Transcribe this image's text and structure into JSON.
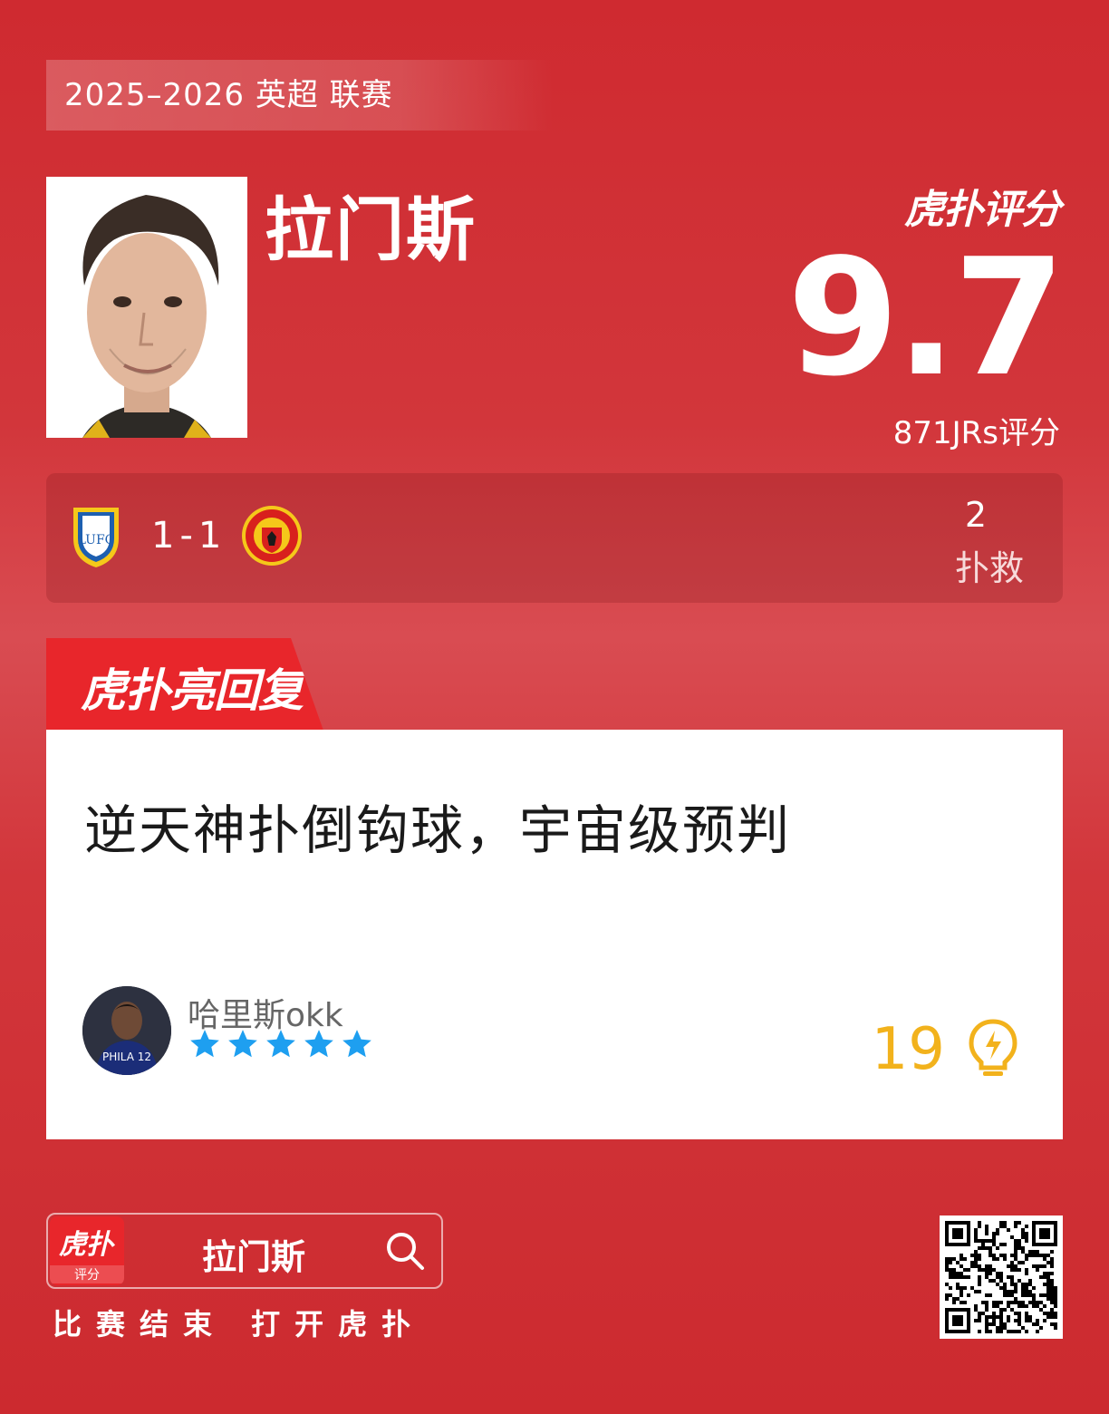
{
  "header": {
    "season_label": "2025–2026 英超 联赛"
  },
  "player": {
    "name": "拉门斯",
    "photo_alt": "player-photo"
  },
  "rating": {
    "brand": "虎扑评分",
    "score": "9.7",
    "raters": "871JRs评分"
  },
  "match": {
    "home_crest": "leeds-crest-icon",
    "score": "1-1",
    "away_crest": "manchester-united-crest-icon",
    "stat_value": "2",
    "stat_label": "扑救"
  },
  "reply": {
    "tab_label": "虎扑亮回复",
    "text": "逆天神扑倒钩球，宇宙级预判",
    "username": "哈里斯okk",
    "stars": 5,
    "likes": "19",
    "avatar_jersey": "PHILA 12"
  },
  "footer": {
    "app_icon_main": "虎扑",
    "app_icon_sub": "评分",
    "search_name": "拉门斯",
    "tagline": "比赛结束 打开虎扑"
  },
  "colors": {
    "background": "#cf2a30",
    "accent_red": "#e8262b",
    "star_blue": "#1e9ff0",
    "like_gold": "#f2b21c"
  }
}
